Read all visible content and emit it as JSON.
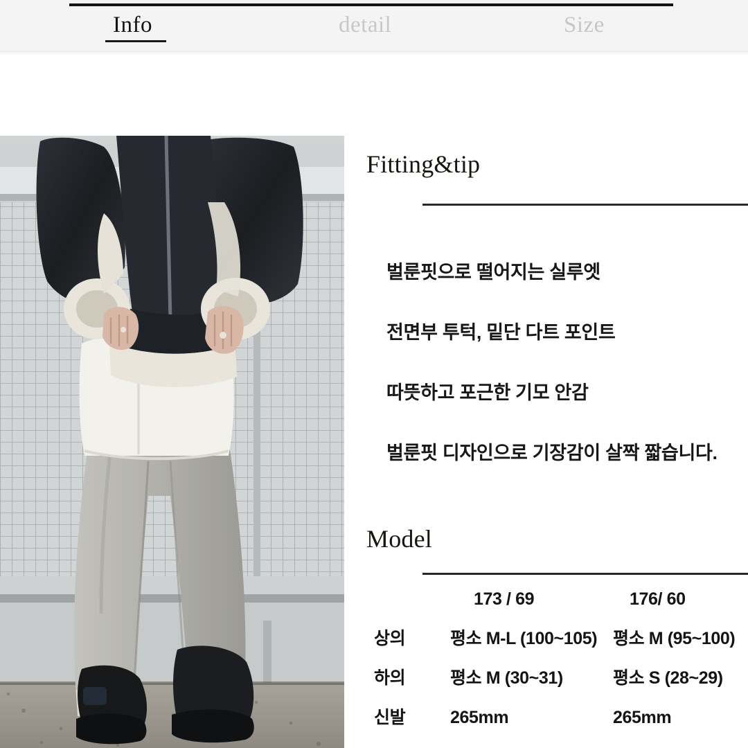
{
  "tabs": [
    {
      "label": "Info",
      "state": "active",
      "name": "tab-info"
    },
    {
      "label": "detail",
      "state": "inactive",
      "name": "tab-detail"
    },
    {
      "label": "Size",
      "state": "inactive",
      "name": "tab-size"
    }
  ],
  "photo": {
    "alt": "Model wearing black leather shearling jacket, white shirt and grey wide-leg balloon-fit pants with black chunky boots, standing by a wire mesh fence",
    "colors": {
      "fence": "#c3c7c8",
      "jacket": "#23252a",
      "shearling": "#e8e4da",
      "shirt": "#f2f0ea",
      "pants": "#b4b3ad",
      "boots": "#17181a",
      "floor": "#9a958c"
    }
  },
  "fitting": {
    "heading": "Fitting&tip",
    "lines": [
      "벌룬핏으로 떨어지는 실루엣",
      "전면부 투턱, 밑단 다트 포인트",
      "따뜻하고 포근한 기모 안감",
      "벌룬핏 디자인으로 기장감이 살짝 짧습니다."
    ]
  },
  "model": {
    "heading": "Model",
    "columns": [
      "",
      "173 / 69",
      "176/ 60"
    ],
    "rows": [
      {
        "label": "상의",
        "c1": "평소 M-L (100~105)",
        "c2": "평소 M (95~100)"
      },
      {
        "label": "하의",
        "c1": "평소 M (30~31)",
        "c2": "평소 S (28~29)"
      },
      {
        "label": "신발",
        "c1": "265mm",
        "c2": "265mm"
      }
    ]
  },
  "colors": {
    "text": "#141414",
    "muted": "#c8c7c7",
    "rule": "#2a2725",
    "tabbar_bg": "#f4f4f5"
  }
}
